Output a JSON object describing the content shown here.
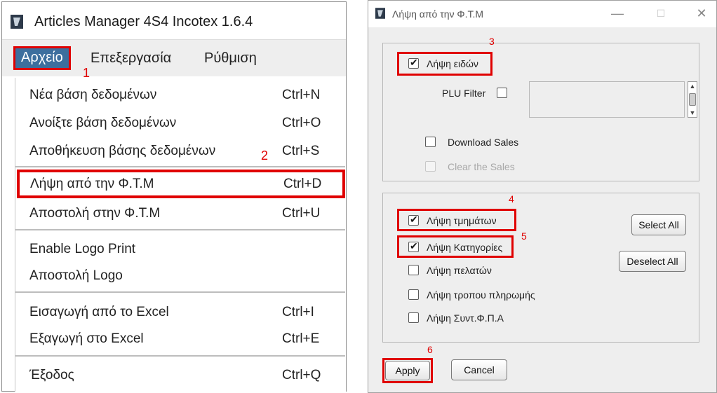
{
  "left_window": {
    "title": "Articles Manager  4S4 Incotex 1.6.4",
    "menubar": [
      "Αρχείο",
      "Επεξεργασία",
      "Ρύθμιση"
    ],
    "menu_items": [
      {
        "label": "Νέα βάση δεδομένων",
        "shortcut": "Ctrl+N"
      },
      {
        "label": "Ανοίξτε βάση δεδομένων",
        "shortcut": "Ctrl+O"
      },
      {
        "label": "Αποθήκευση βάσης δεδομένων",
        "shortcut": "Ctrl+S"
      },
      {
        "label": "Λήψη από την Φ.Τ.Μ",
        "shortcut": "Ctrl+D"
      },
      {
        "label": "Αποστολή στην Φ.Τ.Μ",
        "shortcut": "Ctrl+U"
      },
      {
        "label": "Enable Logo Print",
        "shortcut": ""
      },
      {
        "label": "Αποστολή Logo",
        "shortcut": ""
      },
      {
        "label": "Εισαγωγή από το Excel",
        "shortcut": "Ctrl+I"
      },
      {
        "label": "Εξαγωγή στο Excel",
        "shortcut": "Ctrl+E"
      },
      {
        "label": "Έξοδος",
        "shortcut": "Ctrl+Q"
      }
    ]
  },
  "right_window": {
    "title": "Λήψη από την Φ.Τ.Μ",
    "controls": {
      "minimize": "—",
      "maximize": "☐",
      "close": "✕"
    },
    "panel1": {
      "get_items": {
        "label": "Λήψη ειδών",
        "checked": true
      },
      "plu_filter": {
        "label": "PLU Filter",
        "checked": false,
        "text": ""
      },
      "download_sales": {
        "label": "Download Sales",
        "checked": false
      },
      "clear_sales": {
        "label": "Clear the Sales",
        "checked": false,
        "disabled": true
      }
    },
    "panel2": {
      "options": [
        {
          "label": "Λήψη τμημάτων",
          "checked": true
        },
        {
          "label": "Λήψη Κατηγορίες",
          "checked": true
        },
        {
          "label": "Λήψη πελατών",
          "checked": false
        },
        {
          "label": "Λήψη τροπου πληρωμής",
          "checked": false
        },
        {
          "label": "Λήψη Συντ.Φ.Π.Α",
          "checked": false
        }
      ],
      "select_all": "Select All",
      "deselect_all": "Deselect All"
    },
    "apply": "Apply",
    "cancel": "Cancel"
  },
  "annotations": [
    "1",
    "2",
    "3",
    "4",
    "5",
    "6"
  ],
  "colors": {
    "highlight": "#e00000",
    "menu_selected": "#3d6f9e"
  }
}
